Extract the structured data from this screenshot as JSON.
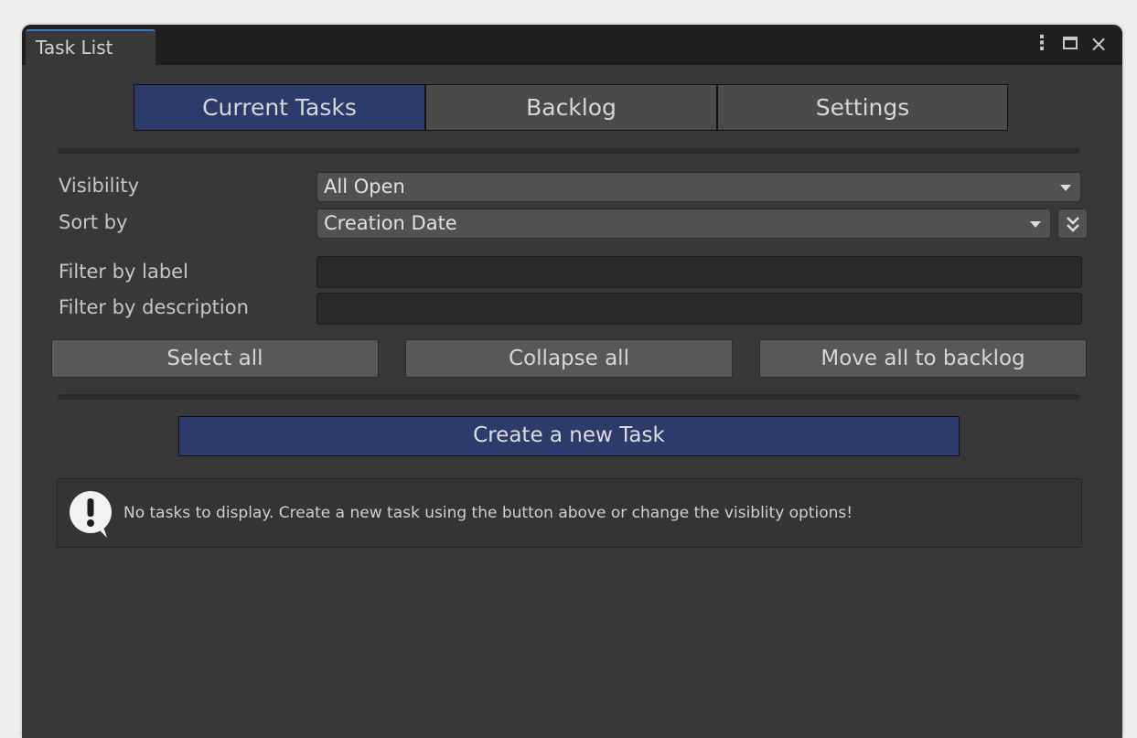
{
  "window": {
    "tab_title": "Task List",
    "menu_icon": "kebab-menu-icon",
    "maximize_icon": "maximize-icon",
    "close_icon": "close-icon"
  },
  "segments": {
    "items": [
      {
        "label": "Current Tasks",
        "active": true
      },
      {
        "label": "Backlog",
        "active": false
      },
      {
        "label": "Settings",
        "active": false
      }
    ]
  },
  "options": {
    "visibility_label": "Visibility",
    "visibility_value": "All Open",
    "sort_label": "Sort by",
    "sort_value": "Creation Date",
    "sort_direction_icon": "chevron-double-down-icon",
    "filter_label_label": "Filter by label",
    "filter_label_value": "",
    "filter_description_label": "Filter by description",
    "filter_description_value": ""
  },
  "actions": {
    "select_all": "Select all",
    "collapse_all": "Collapse all",
    "move_all": "Move all to backlog",
    "create_task": "Create a new Task"
  },
  "help": {
    "icon": "info-speech-bubble-icon",
    "message": "No tasks to display. Create a new task using the button above or change the visiblity options!"
  },
  "colors": {
    "accent": "#2c3b6b",
    "panel_bg": "#383838",
    "titlebar_bg": "#1f1f1f",
    "tab_highlight": "#3a79bb"
  }
}
